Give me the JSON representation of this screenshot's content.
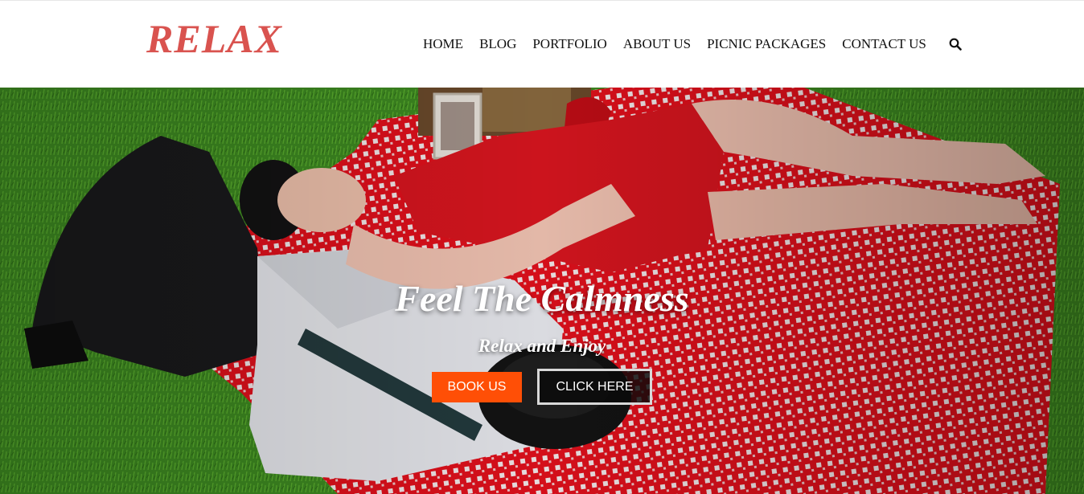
{
  "header": {
    "logo": "RELAX",
    "nav": [
      "HOME",
      "BLOG",
      "PORTFOLIO",
      "ABOUT US",
      "PICNIC PACKAGES",
      "CONTACT US"
    ],
    "search_icon": "search-icon"
  },
  "hero": {
    "title": "Feel The Calmness",
    "subtitle": "Relax and Enjoy",
    "book_button": "BOOK US",
    "click_button": "CLICK HERE"
  },
  "colors": {
    "logo": "#d9534f",
    "book_button": "#ff4f06",
    "grass": "#3f8a22",
    "blanket": "#e0101c"
  }
}
